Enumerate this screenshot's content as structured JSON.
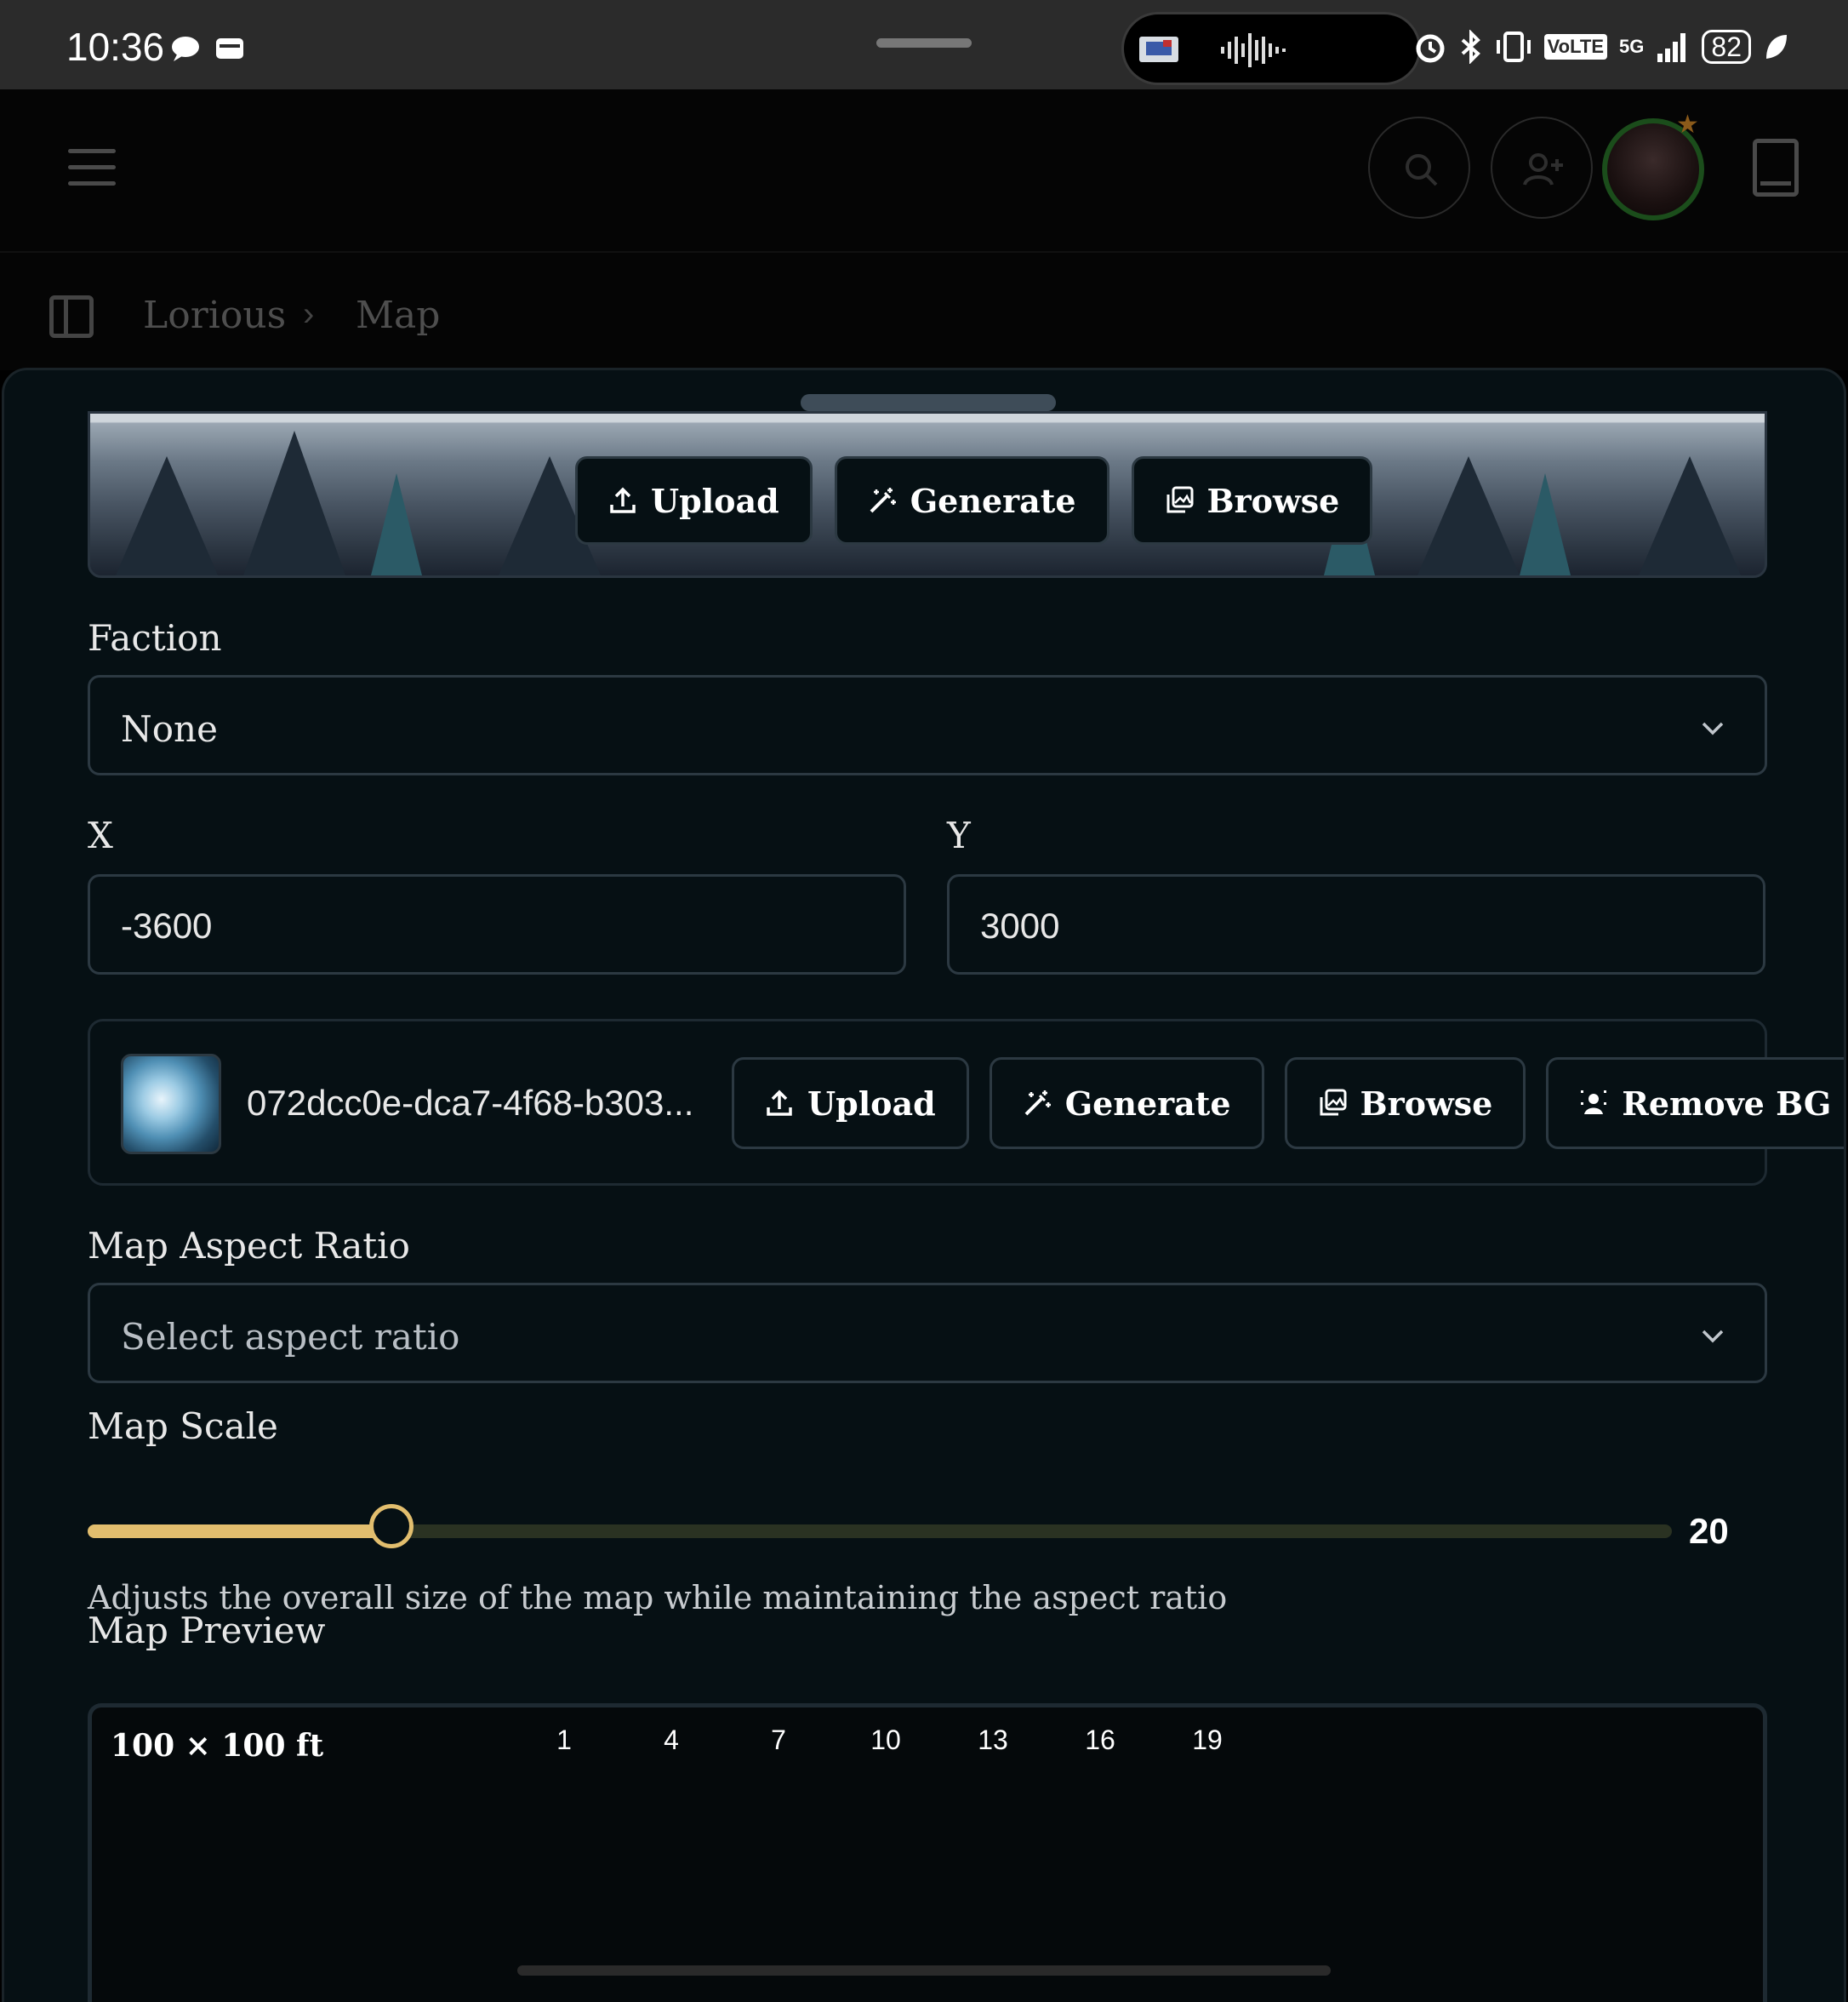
{
  "status_bar": {
    "time": "10:36",
    "battery": "82",
    "network": "5G",
    "volte": "VoLTE",
    "icons": [
      "chat-bubble-icon",
      "wallet-icon",
      "alarm-icon",
      "bluetooth-icon",
      "vibrate-icon",
      "signal-icon",
      "leaf-icon"
    ]
  },
  "header": {
    "icons": [
      "menu-icon",
      "search-icon",
      "add-user-icon",
      "avatar",
      "book-icon"
    ]
  },
  "breadcrumb": {
    "items": [
      "Lorious",
      "Map"
    ]
  },
  "banner": {
    "upload_label": "Upload",
    "generate_label": "Generate",
    "browse_label": "Browse"
  },
  "faction": {
    "label": "Faction",
    "value": "None"
  },
  "coords": {
    "x_label": "X",
    "x_value": "-3600",
    "y_label": "Y",
    "y_value": "3000"
  },
  "map_image": {
    "filename": "072dcc0e-dca7-4f68-b303...",
    "upload_label": "Upload",
    "generate_label": "Generate",
    "browse_label": "Browse",
    "remove_bg_label": "Remove BG"
  },
  "aspect_ratio": {
    "label": "Map Aspect Ratio",
    "placeholder": "Select aspect ratio"
  },
  "map_scale": {
    "label": "Map Scale",
    "value": 20,
    "value_label": "20",
    "min": 1,
    "max": 100,
    "help": "Adjusts the overall size of the map while maintaining the aspect ratio"
  },
  "preview": {
    "label": "Map Preview",
    "dimensions": "100 × 100 ft",
    "ticks": [
      "1",
      "4",
      "7",
      "10",
      "13",
      "16",
      "19"
    ]
  },
  "colors": {
    "accent": "#e2be6e",
    "panel_bg": "#061014",
    "border": "#2c3942"
  }
}
